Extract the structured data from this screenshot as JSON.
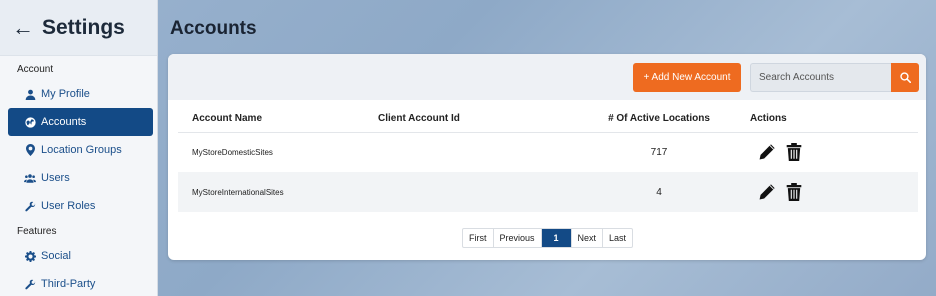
{
  "sidebar": {
    "title": "Settings",
    "sections": [
      {
        "label": "Account"
      },
      {
        "label": "Features"
      }
    ],
    "items": [
      {
        "label": "My Profile",
        "icon": "user-icon"
      },
      {
        "label": "Accounts",
        "icon": "globe-icon",
        "active": true
      },
      {
        "label": "Location Groups",
        "icon": "map-pin-icon"
      },
      {
        "label": "Users",
        "icon": "users-icon"
      },
      {
        "label": "User Roles",
        "icon": "wrench-icon"
      },
      {
        "label": "Social",
        "icon": "gear-icon"
      },
      {
        "label": "Third-Party",
        "icon": "wrench-icon"
      }
    ]
  },
  "main": {
    "title": "Accounts",
    "add_button": "+ Add New Account",
    "search": {
      "placeholder": "Search Accounts"
    },
    "table": {
      "headers": [
        "Account Name",
        "Client Account Id",
        "# Of Active Locations",
        "Actions"
      ],
      "rows": [
        {
          "name": "MyStoreDomesticSites",
          "client_id": "",
          "active_locations": "717"
        },
        {
          "name": "MyStoreInternationalSites",
          "client_id": "",
          "active_locations": "4"
        }
      ]
    },
    "pagination": {
      "first": "First",
      "previous": "Previous",
      "current": "1",
      "next": "Next",
      "last": "Last"
    }
  },
  "colors": {
    "accent": "#ee6b20",
    "primary": "#134a86"
  }
}
